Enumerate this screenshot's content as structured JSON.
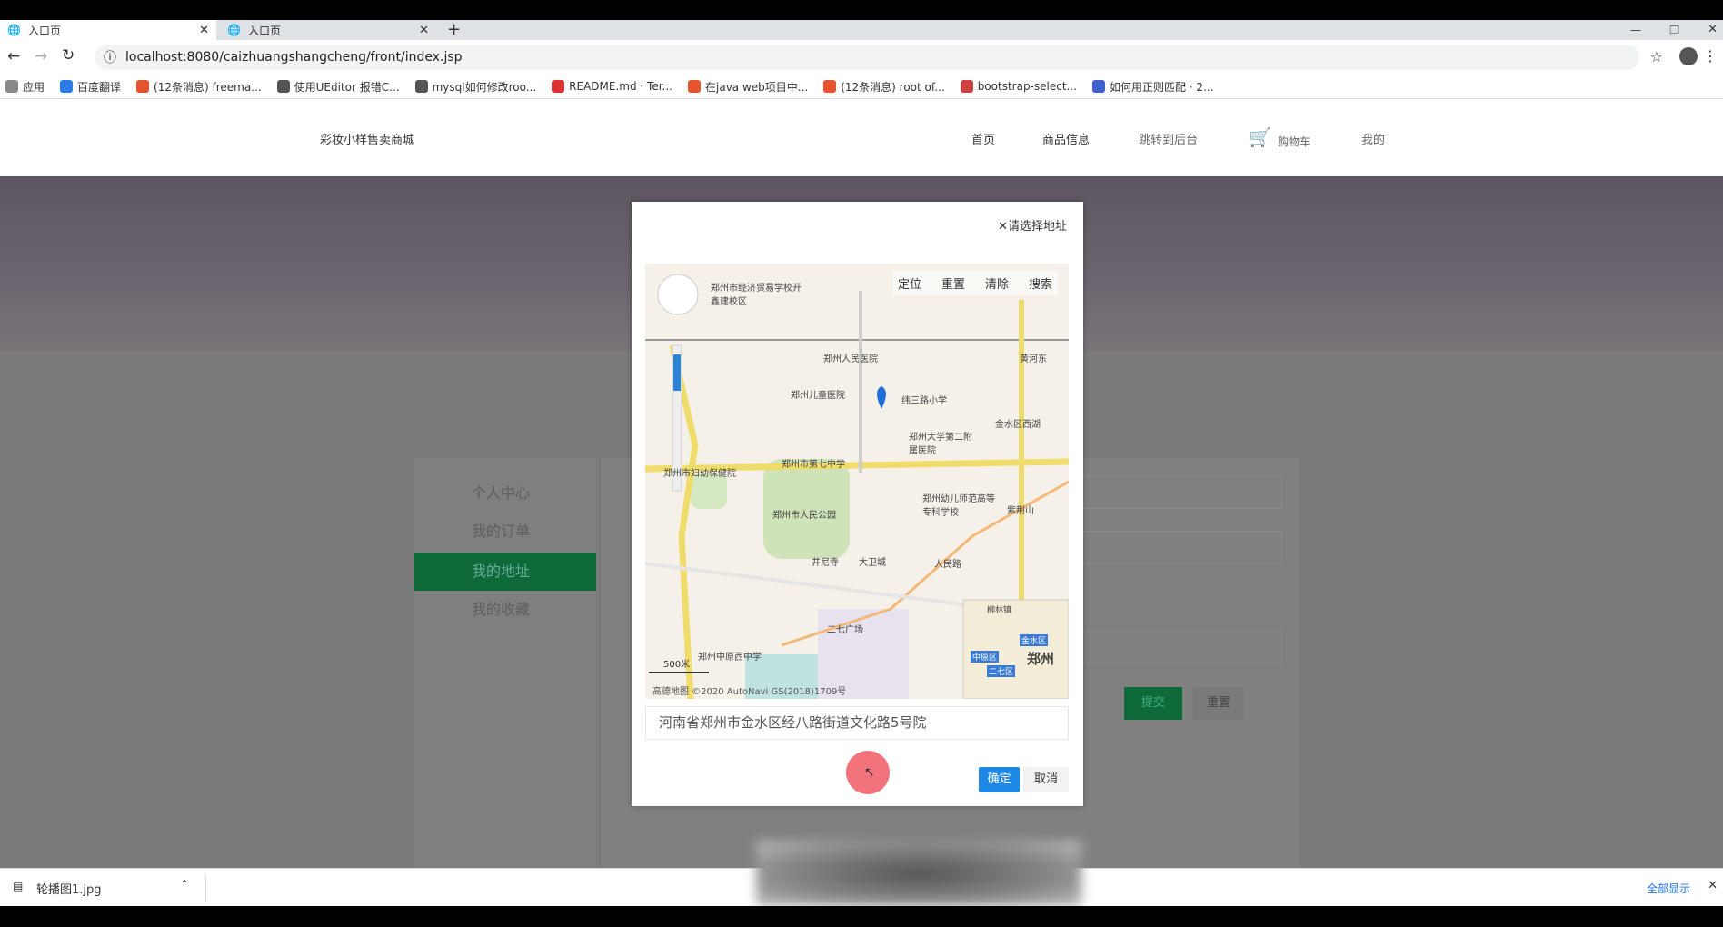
{
  "browser": {
    "tabs": [
      {
        "title": "入口页",
        "active": true
      },
      {
        "title": "入口页",
        "active": false
      }
    ],
    "url": "localhost:8080/caizhuangshangcheng/front/index.jsp",
    "bookmarks": [
      {
        "label": "应用",
        "color": "#888"
      },
      {
        "label": "百度翻译",
        "color": "#2d7be5"
      },
      {
        "label": "(12条消息) freema...",
        "color": "#e5542d"
      },
      {
        "label": "使用UEditor 报错C...",
        "color": "#555"
      },
      {
        "label": "mysql如何修改roo...",
        "color": "#555"
      },
      {
        "label": "README.md · Ter...",
        "color": "#d33"
      },
      {
        "label": "在java web项目中...",
        "color": "#e5542d"
      },
      {
        "label": "(12条消息) root of...",
        "color": "#e5542d"
      },
      {
        "label": "bootstrap-select...",
        "color": "#c44"
      },
      {
        "label": "如何用正则匹配 · 2...",
        "color": "#4060d0"
      }
    ]
  },
  "site": {
    "brand": "彩妆小样售卖商城",
    "nav": [
      "首页",
      "商品信息",
      "跳转到后台",
      "购物车",
      "我的"
    ]
  },
  "sidebar": {
    "items": [
      {
        "label": "个人中心"
      },
      {
        "label": "我的订单"
      },
      {
        "label": "我的地址",
        "active": true
      },
      {
        "label": "我的收藏"
      }
    ]
  },
  "form": {
    "submit": "提交",
    "reset": "重置"
  },
  "modal": {
    "title": "请选择地址",
    "map_buttons": [
      "定位",
      "重置",
      "清除",
      "搜索"
    ],
    "map_labels": [
      "郑州市经济贸易学校开鑫建校区",
      "郑州人民医院",
      "黄河东",
      "郑州儿童医院",
      "纬三路小学",
      "金水区西湖",
      "郑州大学第二附属医院",
      "郑州市第七中学",
      "郑州市妇幼保健院",
      "郑州市人民公园",
      "郑州幼儿师范高等专科学校",
      "紫荆山",
      "井尼寺",
      "大卫城",
      "人民路",
      "二七广场",
      "郑州中原西中学",
      "郑州",
      "金水区",
      "中原区",
      "二七区",
      "柳林镇"
    ],
    "scale": "500米",
    "attribution": "高德地图 ©2020 AutoNavi GS(2018)1709号",
    "address": "河南省郑州市金水区经八路街道文化路5号院",
    "ok": "确定",
    "cancel": "取消"
  },
  "downloads": {
    "file": "轮播图1.jpg",
    "show_all": "全部显示"
  }
}
